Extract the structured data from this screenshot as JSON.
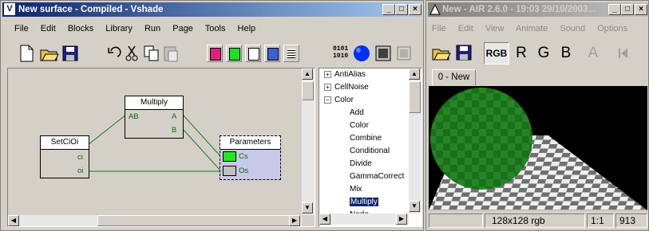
{
  "vshade": {
    "title": "New surface - Compiled - Vshade",
    "app_icon": "V",
    "menu": [
      "File",
      "Edit",
      "Blocks",
      "Library",
      "Run",
      "Page",
      "Tools",
      "Help"
    ],
    "nodes": {
      "multiply": {
        "title": "Multiply",
        "in_ab": "AB",
        "out_a": "A",
        "out_b": "B"
      },
      "setcioi": {
        "title": "SetCiOi",
        "out_ci": "ci",
        "out_oi": "oi"
      },
      "parameters": {
        "title": "Parameters",
        "cs": "Cs",
        "os": "Os",
        "cs_color": "#22e822",
        "os_color": "#c0c0c0"
      }
    },
    "tree": {
      "items": [
        {
          "label": "AntiAlias",
          "kind": "plus"
        },
        {
          "label": "CellNoise",
          "kind": "plus"
        },
        {
          "label": "Color",
          "kind": "minus"
        },
        {
          "label": "Add",
          "kind": "leaf"
        },
        {
          "label": "Color",
          "kind": "leaf"
        },
        {
          "label": "Combine",
          "kind": "leaf"
        },
        {
          "label": "Conditional",
          "kind": "leaf"
        },
        {
          "label": "Divide",
          "kind": "leaf"
        },
        {
          "label": "GammaCorrect",
          "kind": "leaf"
        },
        {
          "label": "Mix",
          "kind": "leaf"
        },
        {
          "label": "Multiply",
          "kind": "selected"
        },
        {
          "label": "Node",
          "kind": "leaf"
        }
      ]
    }
  },
  "air": {
    "title": "New - AIR 2.6.0 - 19:03 29/10/2003...",
    "menu": [
      "File",
      "Edit",
      "View",
      "Animate",
      "Sound",
      "Options"
    ],
    "channels": [
      "RGB",
      "R",
      "G",
      "B",
      "A"
    ],
    "tab": "0 - New",
    "status": {
      "size": "128x128 rgb",
      "zoom": "1:1",
      "value": "913"
    }
  }
}
